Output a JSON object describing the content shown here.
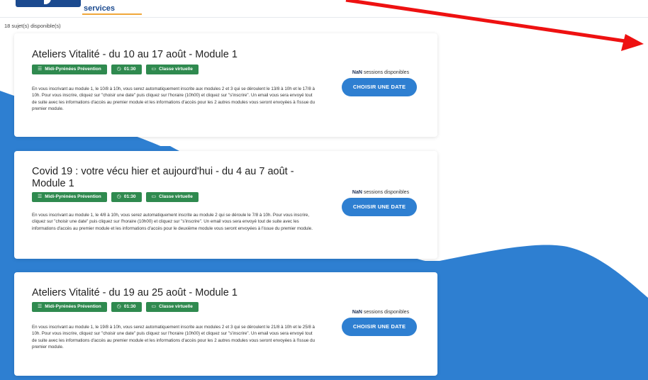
{
  "header": {
    "logo_text": "services"
  },
  "count_text": "18 sujet(s) disponible(s)",
  "colors": {
    "wave": "#2e7fd1",
    "tag": "#2f8a4f",
    "button": "#2e7fd1",
    "arrow": "#ee1111"
  },
  "icons": {
    "list": "list-icon",
    "clock": "clock-icon",
    "screen": "screen-icon",
    "arrow": "arrow-icon"
  },
  "cards": [
    {
      "title": "Ateliers Vitalité - du 10 au 17 août - Module 1",
      "tags": [
        "Midi-Pyrénées Prévention",
        "01:30",
        "Classe virtuelle"
      ],
      "description": "En vous inscrivant au module 1, le 10/8 à 10h, vous serez automatiquement inscrite aux modules 2 et 3 qui se déroulent le 13/8 à 10h et le 17/8 à 10h. Pour vous inscrire, cliquez sur \"choisir une date\" puis cliquez sur l'horaire (10h00) et cliquez sur \"s'inscrire\". Un email vous sera envoyé tout de suite avec les informations d'accès au premier module et les informations d'accès pour les 2 autres modules vous seront envoyées à l'issue du premier module.",
      "availability_count": "NaN",
      "availability_label": "sessions disponibles",
      "button_label": "CHOISIR UNE DATE"
    },
    {
      "title": "Covid 19 : votre vécu hier et aujourd'hui - du 4 au 7 août - Module 1",
      "tags": [
        "Midi-Pyrénées Prévention",
        "01:30",
        "Classe virtuelle"
      ],
      "description": "En vous inscrivant au module 1, le 4/8 à 10h, vous serez automatiquement inscrite au module 2 qui se déroule le 7/8 à 10h. Pour vous inscrire, cliquez sur \"choisir une date\" puis cliquez sur l'horaire (10h00) et cliquez sur \"s'inscrire\". Un email vous sera envoyé tout de suite avec les informations d'accès au premier module et les informations d'accès pour le deuxième module vous seront envoyées à l'issue du premier module.",
      "availability_count": "NaN",
      "availability_label": "sessions disponibles",
      "button_label": "CHOISIR UNE DATE"
    },
    {
      "title": "Ateliers Vitalité - du 19 au 25 août - Module 1",
      "tags": [
        "Midi-Pyrénées Prévention",
        "01:30",
        "Classe virtuelle"
      ],
      "description": "En vous inscrivant au module 1, le 19/8 à 10h, vous serez automatiquement inscrite aux modules 2 et 3 qui se déroulent le 21/8 à 10h et le 25/8 à 10h. Pour vous inscrire, cliquez sur \"choisir une date\" puis cliquez sur l'horaire (10h00) et cliquez sur \"s'inscrire\". Un email vous sera envoyé tout de suite avec les informations d'accès au premier module et les informations d'accès pour les 2 autres modules vous seront envoyées à l'issue du premier module.",
      "availability_count": "NaN",
      "availability_label": "sessions disponibles",
      "button_label": "CHOISIR UNE DATE"
    }
  ]
}
